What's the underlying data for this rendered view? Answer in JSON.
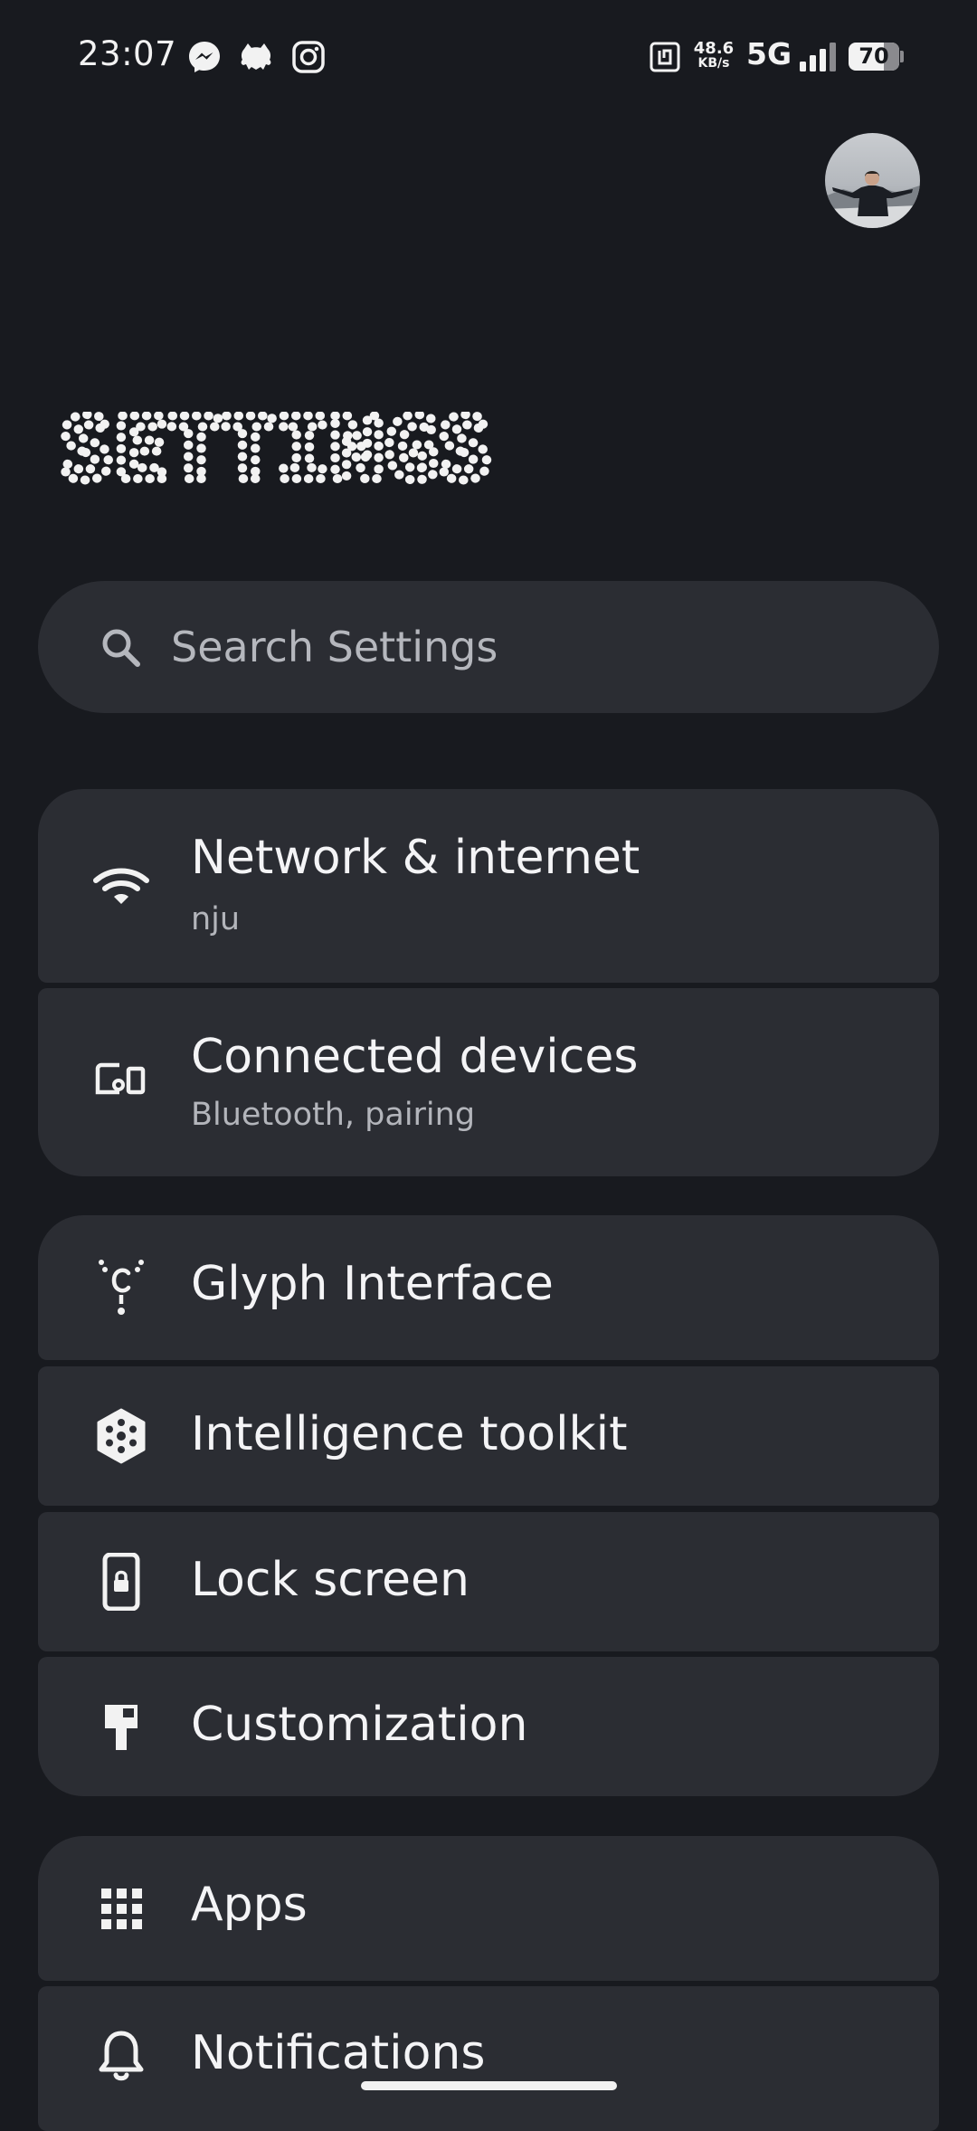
{
  "status_bar": {
    "time": "23:07",
    "notification_icons": [
      "messenger-icon",
      "cat-app-icon",
      "instagram-icon"
    ],
    "net_speed_value": "48.6",
    "net_speed_unit": "KB/s",
    "network_type": "5G",
    "battery_level": "70",
    "battery_fraction": 0.7
  },
  "header": {
    "title": "SETTINGS"
  },
  "search": {
    "placeholder": "Search Settings"
  },
  "groups": [
    {
      "items": [
        {
          "icon": "wifi-icon",
          "title": "Network & internet",
          "subtitle": "nju"
        },
        {
          "icon": "devices-icon",
          "title": "Connected devices",
          "subtitle": "Bluetooth, pairing"
        }
      ]
    },
    {
      "items": [
        {
          "icon": "glyph-icon",
          "title": "Glyph Interface"
        },
        {
          "icon": "sparkle-hexagon-icon",
          "title": "Intelligence toolkit"
        },
        {
          "icon": "lock-phone-icon",
          "title": "Lock screen"
        },
        {
          "icon": "paint-roller-icon",
          "title": "Customization"
        }
      ]
    },
    {
      "items": [
        {
          "icon": "apps-grid-icon",
          "title": "Apps"
        },
        {
          "icon": "bell-icon",
          "title": "Notifications"
        }
      ]
    }
  ],
  "colors": {
    "background": "#181a1f",
    "card": "#2b2d33",
    "text_primary": "#f4f4f6",
    "text_secondary": "#b3b5bb"
  }
}
